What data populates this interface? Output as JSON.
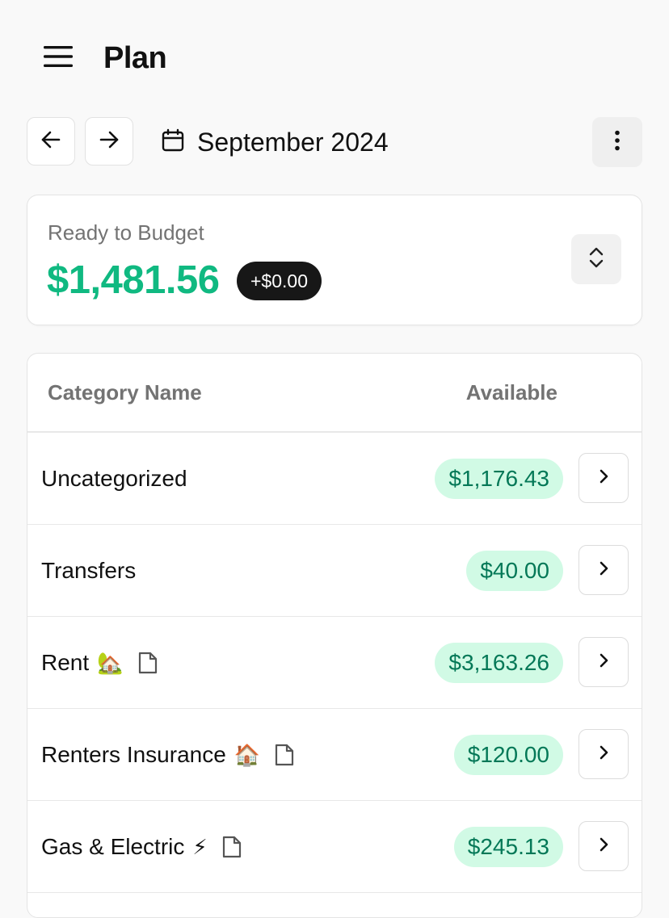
{
  "header": {
    "title": "Plan"
  },
  "month_nav": {
    "month_label": "September 2024"
  },
  "budget": {
    "label": "Ready to Budget",
    "amount": "$1,481.56",
    "delta": "+$0.00",
    "colors": {
      "amount": "#10b981",
      "delta_bg": "#171717"
    }
  },
  "table": {
    "headers": {
      "name": "Category Name",
      "available": "Available"
    },
    "rows": [
      {
        "name": "Uncategorized",
        "emoji": "",
        "has_note": false,
        "available": "$1,176.43"
      },
      {
        "name": "Transfers",
        "emoji": "",
        "has_note": false,
        "available": "$40.00"
      },
      {
        "name": "Rent",
        "emoji": "🏡",
        "has_note": true,
        "available": "$3,163.26"
      },
      {
        "name": "Renters Insurance",
        "emoji": "🏠",
        "has_note": true,
        "available": "$120.00"
      },
      {
        "name": "Gas & Electric",
        "emoji": "⚡",
        "has_note": true,
        "available": "$245.13"
      }
    ],
    "colors": {
      "badge_bg": "#d1fae5",
      "badge_text": "#047857"
    }
  },
  "icons": {
    "menu": "hamburger-menu-icon",
    "prev": "arrow-left-icon",
    "next": "arrow-right-icon",
    "calendar": "calendar-icon",
    "more": "vertical-ellipsis-icon",
    "toggle": "chevron-up-down-icon",
    "note": "note-icon",
    "row_action": "chevron-right-icon"
  }
}
